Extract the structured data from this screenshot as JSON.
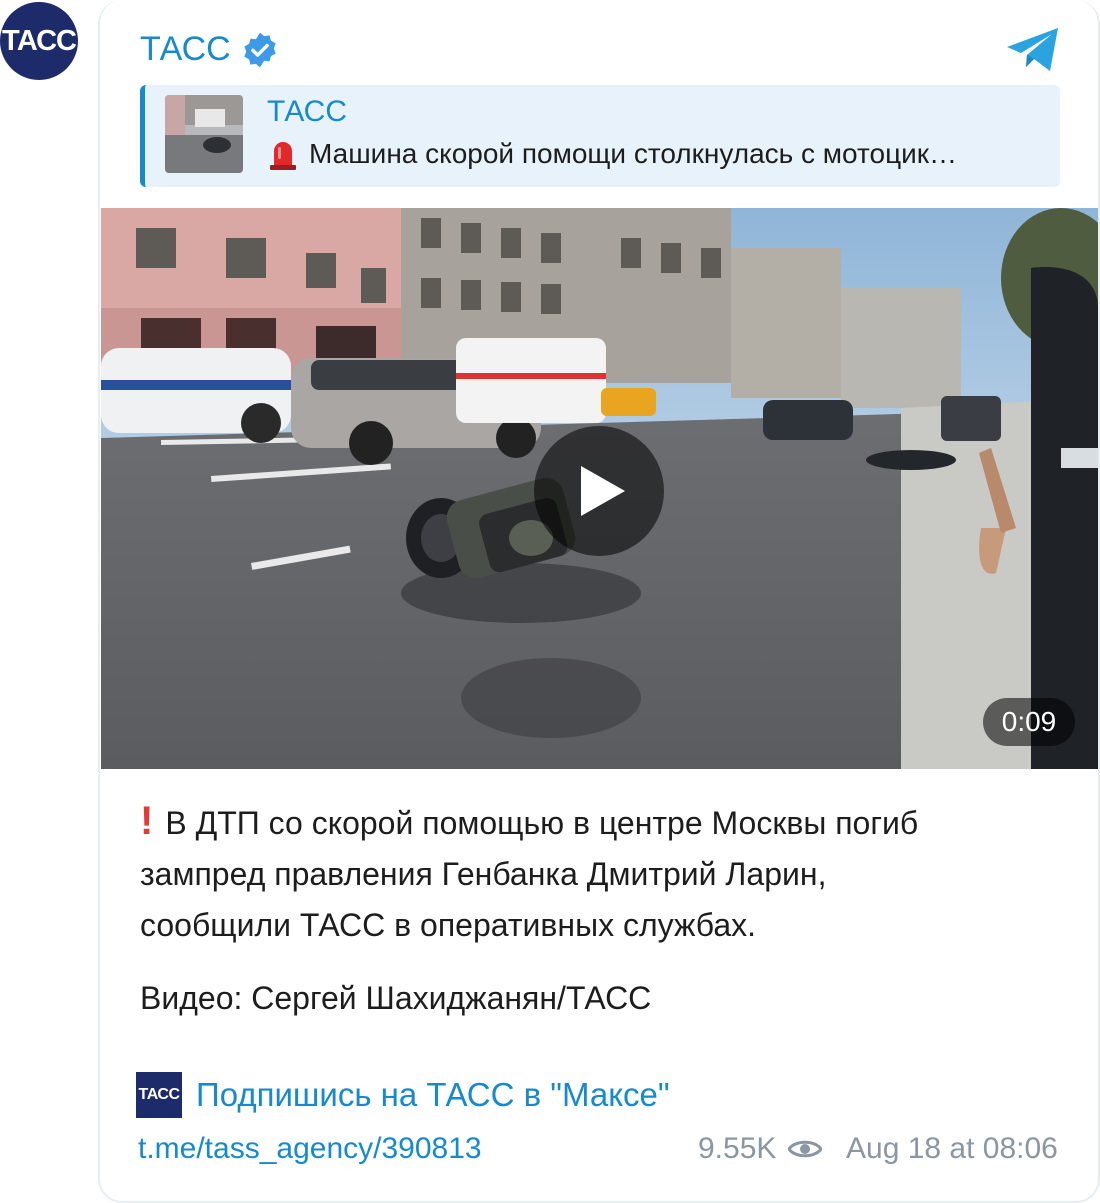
{
  "channel": {
    "avatar_text": "ТАСС",
    "name": "ТАСС"
  },
  "reply": {
    "title": "ТАСС",
    "text": "Машина скорой помощи столкнулась с мотоцик…"
  },
  "video": {
    "duration": "0:09"
  },
  "post": {
    "body": "В ДТП со скорой помощью в центре Москвы погиб\nзампред правления Генбанка Дмитрий Ларин,\nсообщили ТАСС в оперативных службах.",
    "credit": "Видео: Сергей Шахиджанян/ТАСС"
  },
  "promo": {
    "logo_text": "ТАСС",
    "text": "Подпишись на ТАСС в \"Максе\""
  },
  "footer": {
    "link": "t.me/tass_agency/390813",
    "views": "9.55K",
    "timestamp": "Aug 18 at 08:06"
  },
  "colors": {
    "link_blue": "#168acd",
    "tass_navy": "#1d2b6b",
    "reply_bg": "#e7f2fa",
    "meta_gray": "#8a96a3",
    "alert_red": "#e53935"
  }
}
